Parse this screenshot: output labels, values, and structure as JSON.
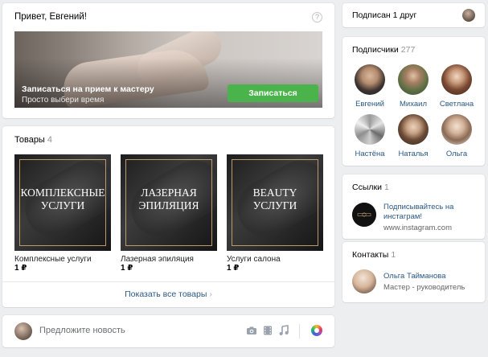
{
  "welcome": {
    "greeting": "Привет, Евгений!",
    "help_glyph": "?",
    "banner_title": "Записаться на прием к мастеру",
    "banner_subtitle": "Просто выбери время",
    "banner_button": "Записаться"
  },
  "products": {
    "header": "Товары",
    "count": "4",
    "items": [
      {
        "cover_line1": "КОМПЛЕКСНЫЕ",
        "cover_line2": "УСЛУГИ",
        "name": "Комплексные услуги",
        "price": "1 ₽"
      },
      {
        "cover_line1": "ЛАЗЕРНАЯ",
        "cover_line2": "ЭПИЛЯЦИЯ",
        "name": "Лазерная эпиляция",
        "price": "1 ₽"
      },
      {
        "cover_line1": "BEAUTY",
        "cover_line2": "УСЛУГИ",
        "name": "Услуги салона",
        "price": "1 ₽"
      }
    ],
    "show_all": "Показать все товары",
    "show_all_chevron": "›"
  },
  "suggest": {
    "placeholder": "Предложите новость",
    "icons": [
      "camera-icon",
      "video-icon",
      "music-icon",
      "color-picker-icon"
    ]
  },
  "friend": {
    "label": "Подписан 1 друг"
  },
  "subscribers": {
    "header": "Подписчики",
    "count": "277",
    "people": [
      {
        "name": "Евгений"
      },
      {
        "name": "Михаил"
      },
      {
        "name": "Светлана"
      },
      {
        "name": "Настёна"
      },
      {
        "name": "Наталья"
      },
      {
        "name": "Ольга"
      }
    ]
  },
  "links": {
    "header": "Ссылки",
    "count": "1",
    "item_title": "Подписывайтесь на инстаграм!",
    "item_url": "www.instagram.com"
  },
  "contacts": {
    "header": "Контакты",
    "count": "1",
    "name": "Ольга Тайманова",
    "role": "Мастер - руководитель"
  },
  "colors": {
    "background": "#edeef0",
    "link": "#2a5885",
    "button_green": "#4bb34b",
    "muted": "#939393"
  }
}
